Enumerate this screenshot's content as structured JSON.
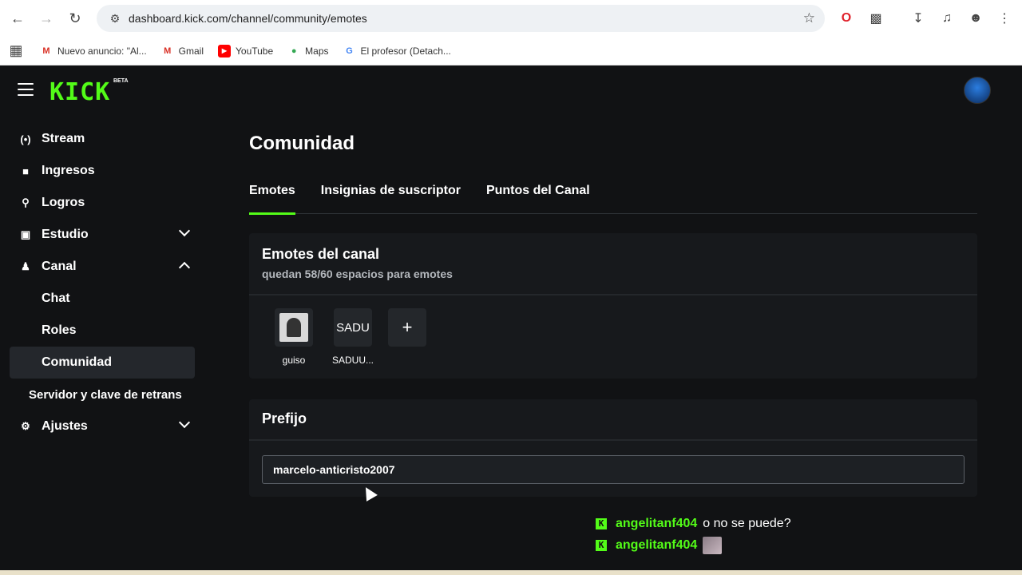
{
  "browser": {
    "url": "dashboard.kick.com/channel/community/emotes",
    "bookmarks": [
      {
        "label": "Nuevo anuncio: \"Al...",
        "icon": "gmail-icon"
      },
      {
        "label": "Gmail",
        "icon": "gmail-icon"
      },
      {
        "label": "YouTube",
        "icon": "youtube-icon"
      },
      {
        "label": "Maps",
        "icon": "maps-icon"
      },
      {
        "label": "El profesor (Detach...",
        "icon": "google-icon"
      }
    ]
  },
  "app": {
    "logo": "KICK",
    "logo_badge": "BETA",
    "accent": "#53fc18"
  },
  "sidebar": {
    "items": [
      {
        "label": "Stream",
        "icon": "stream-icon"
      },
      {
        "label": "Ingresos",
        "icon": "chart-icon"
      },
      {
        "label": "Logros",
        "icon": "trophy-icon"
      },
      {
        "label": "Estudio",
        "icon": "studio-icon",
        "expanded": false
      },
      {
        "label": "Canal",
        "icon": "users-icon",
        "expanded": true
      },
      {
        "label": "Chat"
      },
      {
        "label": "Roles"
      },
      {
        "label": "Comunidad",
        "active": true
      },
      {
        "label": "Servidor y clave de retrans"
      },
      {
        "label": "Ajustes",
        "icon": "gear-icon",
        "expanded": false
      }
    ]
  },
  "main": {
    "title": "Comunidad",
    "tabs": [
      {
        "label": "Emotes",
        "active": true
      },
      {
        "label": "Insignias de suscriptor"
      },
      {
        "label": "Puntos del Canal"
      }
    ],
    "emotes_card": {
      "title": "Emotes del canal",
      "subtitle": "quedan 58/60 espacios para emotes",
      "emotes": [
        {
          "label": "guiso"
        },
        {
          "label": "SADUU...",
          "broken_alt": "SADU"
        }
      ],
      "add_label": "+"
    },
    "prefix_card": {
      "title": "Prefijo",
      "value": "marcelo-anticristo2007"
    }
  },
  "chat": [
    {
      "user": "angelitanf404",
      "message": "o no se puede?"
    },
    {
      "user": "angelitanf404",
      "message": ""
    }
  ]
}
